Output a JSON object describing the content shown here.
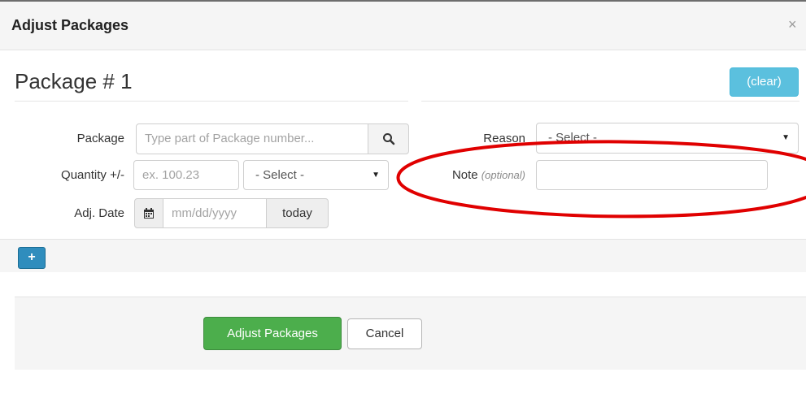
{
  "dialog": {
    "title": "Adjust Packages",
    "close_label": "×"
  },
  "package_section": {
    "title": "Package # 1",
    "clear_label": "(clear)"
  },
  "form": {
    "package": {
      "label": "Package",
      "placeholder": "Type part of Package number...",
      "search_icon": "search-icon"
    },
    "quantity": {
      "label": "Quantity +/-",
      "placeholder": "ex. 100.23",
      "unit_select": "- Select -"
    },
    "adj_date": {
      "label": "Adj. Date",
      "calendar_icon": "calendar-icon",
      "placeholder": "mm/dd/yyyy",
      "today_label": "today"
    },
    "reason": {
      "label": "Reason",
      "select": "- Select -"
    },
    "note": {
      "label": "Note",
      "optional": "(optional)",
      "value": ""
    }
  },
  "add_button": {
    "label": "+"
  },
  "footer": {
    "submit_label": "Adjust Packages",
    "cancel_label": "Cancel"
  },
  "colors": {
    "info_button": "#5bc0de",
    "primary_button": "#2f8dbd",
    "success_button": "#4cae4c",
    "annotation_red": "#e00000"
  }
}
